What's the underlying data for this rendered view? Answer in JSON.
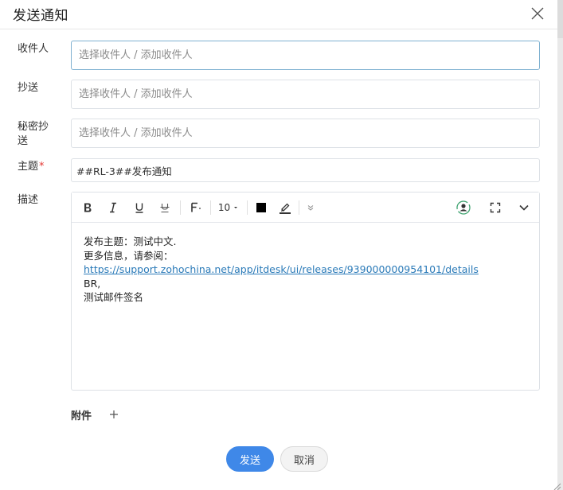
{
  "dialog": {
    "title": "发送通知"
  },
  "fields": {
    "to": {
      "label": "收件人",
      "placeholder": "选择收件人 / 添加收件人"
    },
    "cc": {
      "label": "抄送",
      "placeholder": "选择收件人 / 添加收件人"
    },
    "bcc": {
      "label_line1": "秘密抄",
      "label_line2": "送",
      "placeholder": "选择收件人 / 添加收件人"
    },
    "subject": {
      "label": "主题",
      "required_mark": "*",
      "value": "##RL-3##发布通知"
    },
    "description": {
      "label": "描述"
    }
  },
  "toolbar": {
    "font_size": "10",
    "icons": [
      "bold-icon",
      "italic-icon",
      "underline-icon",
      "strikethrough-icon",
      "font-icon",
      "text-color-icon",
      "highlight-icon",
      "more-icon",
      "user-sync-icon",
      "fullscreen-icon",
      "chevron-down-icon"
    ],
    "text_color": "#000000"
  },
  "body": {
    "line1": "发布主题：测试中文.",
    "line2": "更多信息，请参阅：",
    "link": "https://support.zohochina.net/app/itdesk/ui/releases/939000000954101/details",
    "line4": "BR,",
    "line5": "测试邮件签名"
  },
  "attachments": {
    "label": "附件"
  },
  "buttons": {
    "send": "发送",
    "cancel": "取消"
  },
  "colors": {
    "primary": "#3f88e8",
    "link": "#2a7ab8",
    "required": "#e53935",
    "focus_border": "#7fb1d1"
  }
}
